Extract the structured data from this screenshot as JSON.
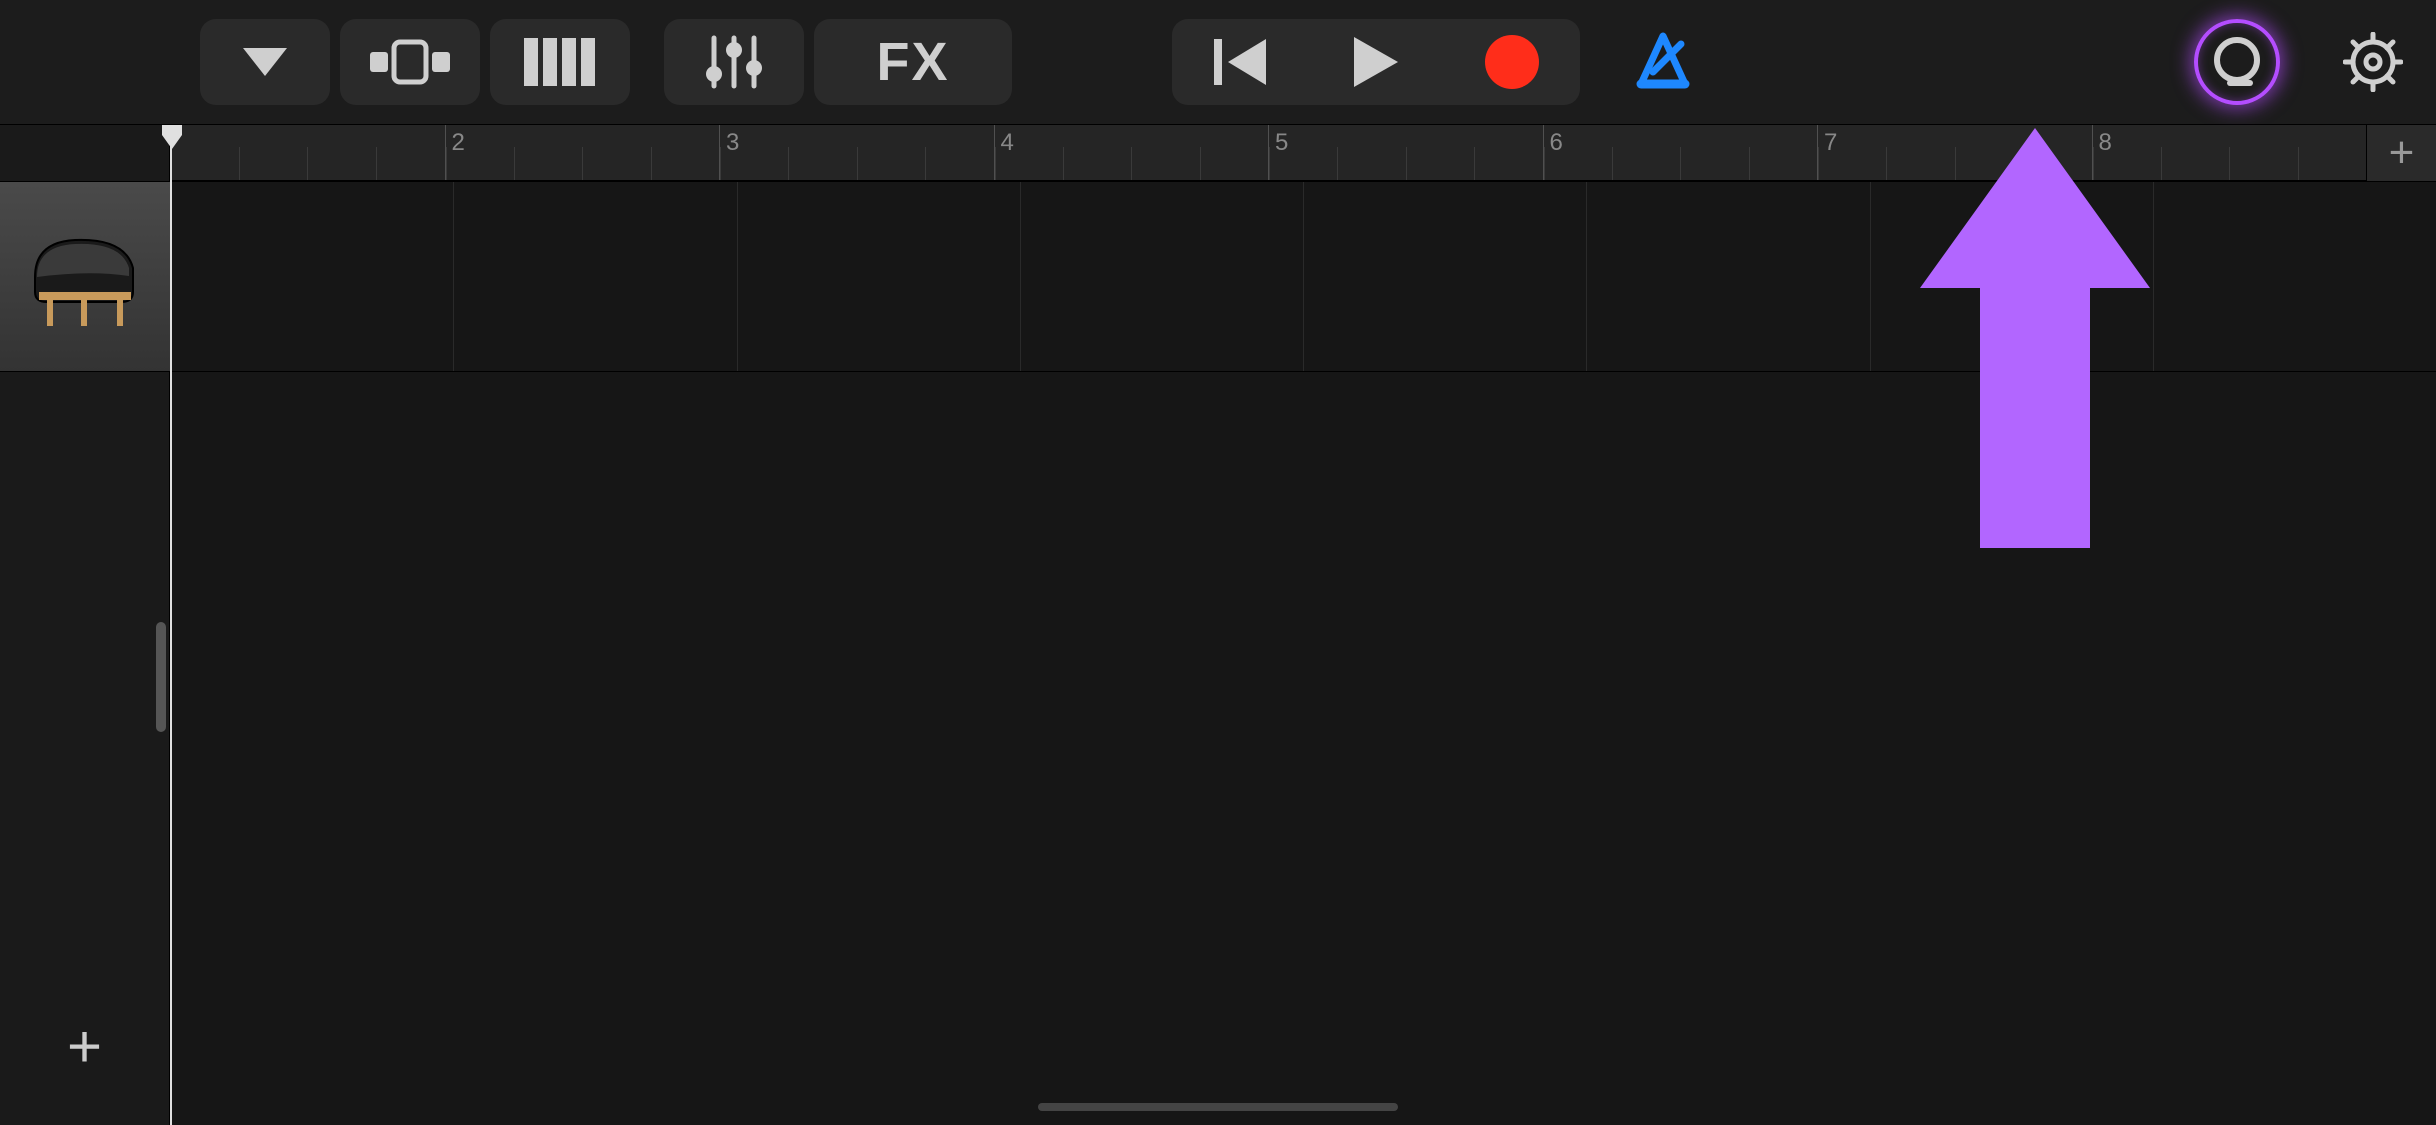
{
  "toolbar": {
    "fx_label": "FX",
    "icons": {
      "dropdown": "song-menu",
      "browser": "browser",
      "instrument": "instrument",
      "controls": "track-controls",
      "fx": "effects",
      "rewind": "go-to-beginning",
      "play": "play",
      "record": "record",
      "metronome": "metronome",
      "loop": "loop-browser",
      "settings": "settings"
    }
  },
  "ruler": {
    "bar_numbers": [
      "",
      "2",
      "3",
      "4",
      "5",
      "6",
      "7",
      "8"
    ],
    "subdivisions": 4,
    "add_label": "+"
  },
  "tracks": [
    {
      "name": "Grand Piano",
      "instrument_icon": "piano-icon"
    }
  ],
  "sidebar": {
    "add_track_label": "+"
  },
  "colors": {
    "metronome": "#1e88ff",
    "record": "#ff2d1a",
    "highlight": "#b44dff",
    "arrow": "#b266ff"
  },
  "annotation": {
    "type": "arrow-up",
    "target": "loop-browser-button"
  }
}
